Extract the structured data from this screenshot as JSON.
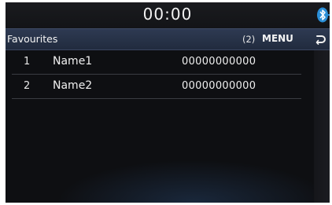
{
  "status_bar": {
    "clock": "00:00",
    "bluetooth_icon": "bluetooth-icon",
    "bluetooth_color": "#2b8fd8"
  },
  "title_bar": {
    "title": "Favourites",
    "count": "(2)",
    "menu_label": "MENU",
    "back_icon": "back-arrow-icon"
  },
  "favourites": [
    {
      "index": "1",
      "name": "Name1",
      "number": "00000000000"
    },
    {
      "index": "2",
      "name": "Name2",
      "number": "00000000000"
    }
  ],
  "colors": {
    "screen_background": "#0e0f12",
    "title_bar": "#2a3549",
    "text": "#f0f0f0"
  }
}
